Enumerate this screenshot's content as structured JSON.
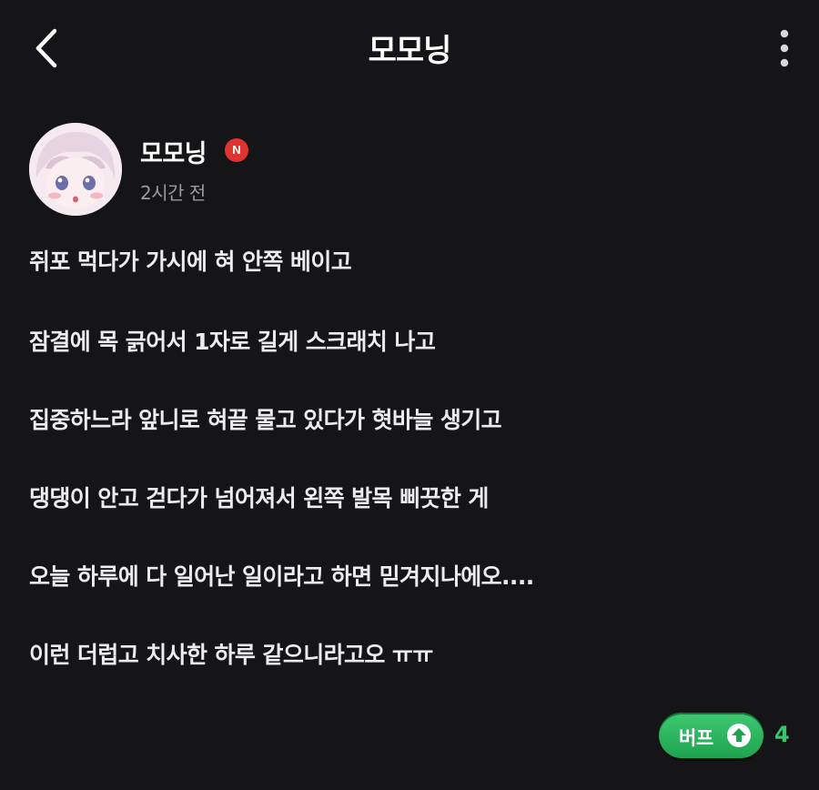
{
  "header": {
    "title": "모모닝",
    "back_icon": "chevron-left-icon",
    "more_icon": "more-vertical-icon"
  },
  "author": {
    "name": "모모닝",
    "badge": "N",
    "time": "2시간 전",
    "avatar_icon": "avatar-icon"
  },
  "post": {
    "lines": [
      "쥐포 먹다가 가시에 혀 안쪽 베이고",
      "잠결에 목 긁어서 1자로 길게 스크래치 나고",
      "집중하느라 앞니로 혀끝 물고 있다가 혓바늘 생기고",
      "댕댕이 안고 걷다가 넘어져서 왼쪽 발목 삐끗한 게",
      "오늘 하루에 다 일어난 일이라고 하면 믿겨지나에오....",
      "이런 더럽고 치사한 하루 같으니라고오 ㅠㅠ"
    ]
  },
  "actions": {
    "buff_label": "버프",
    "buff_icon": "arrow-up-icon",
    "buff_count": "4"
  },
  "colors": {
    "background": "#151517",
    "text": "#ececf0",
    "muted": "#9a9aa2",
    "badge_red": "#e0322e",
    "buff_green": "#2bb35e",
    "count_green": "#35c56d"
  }
}
